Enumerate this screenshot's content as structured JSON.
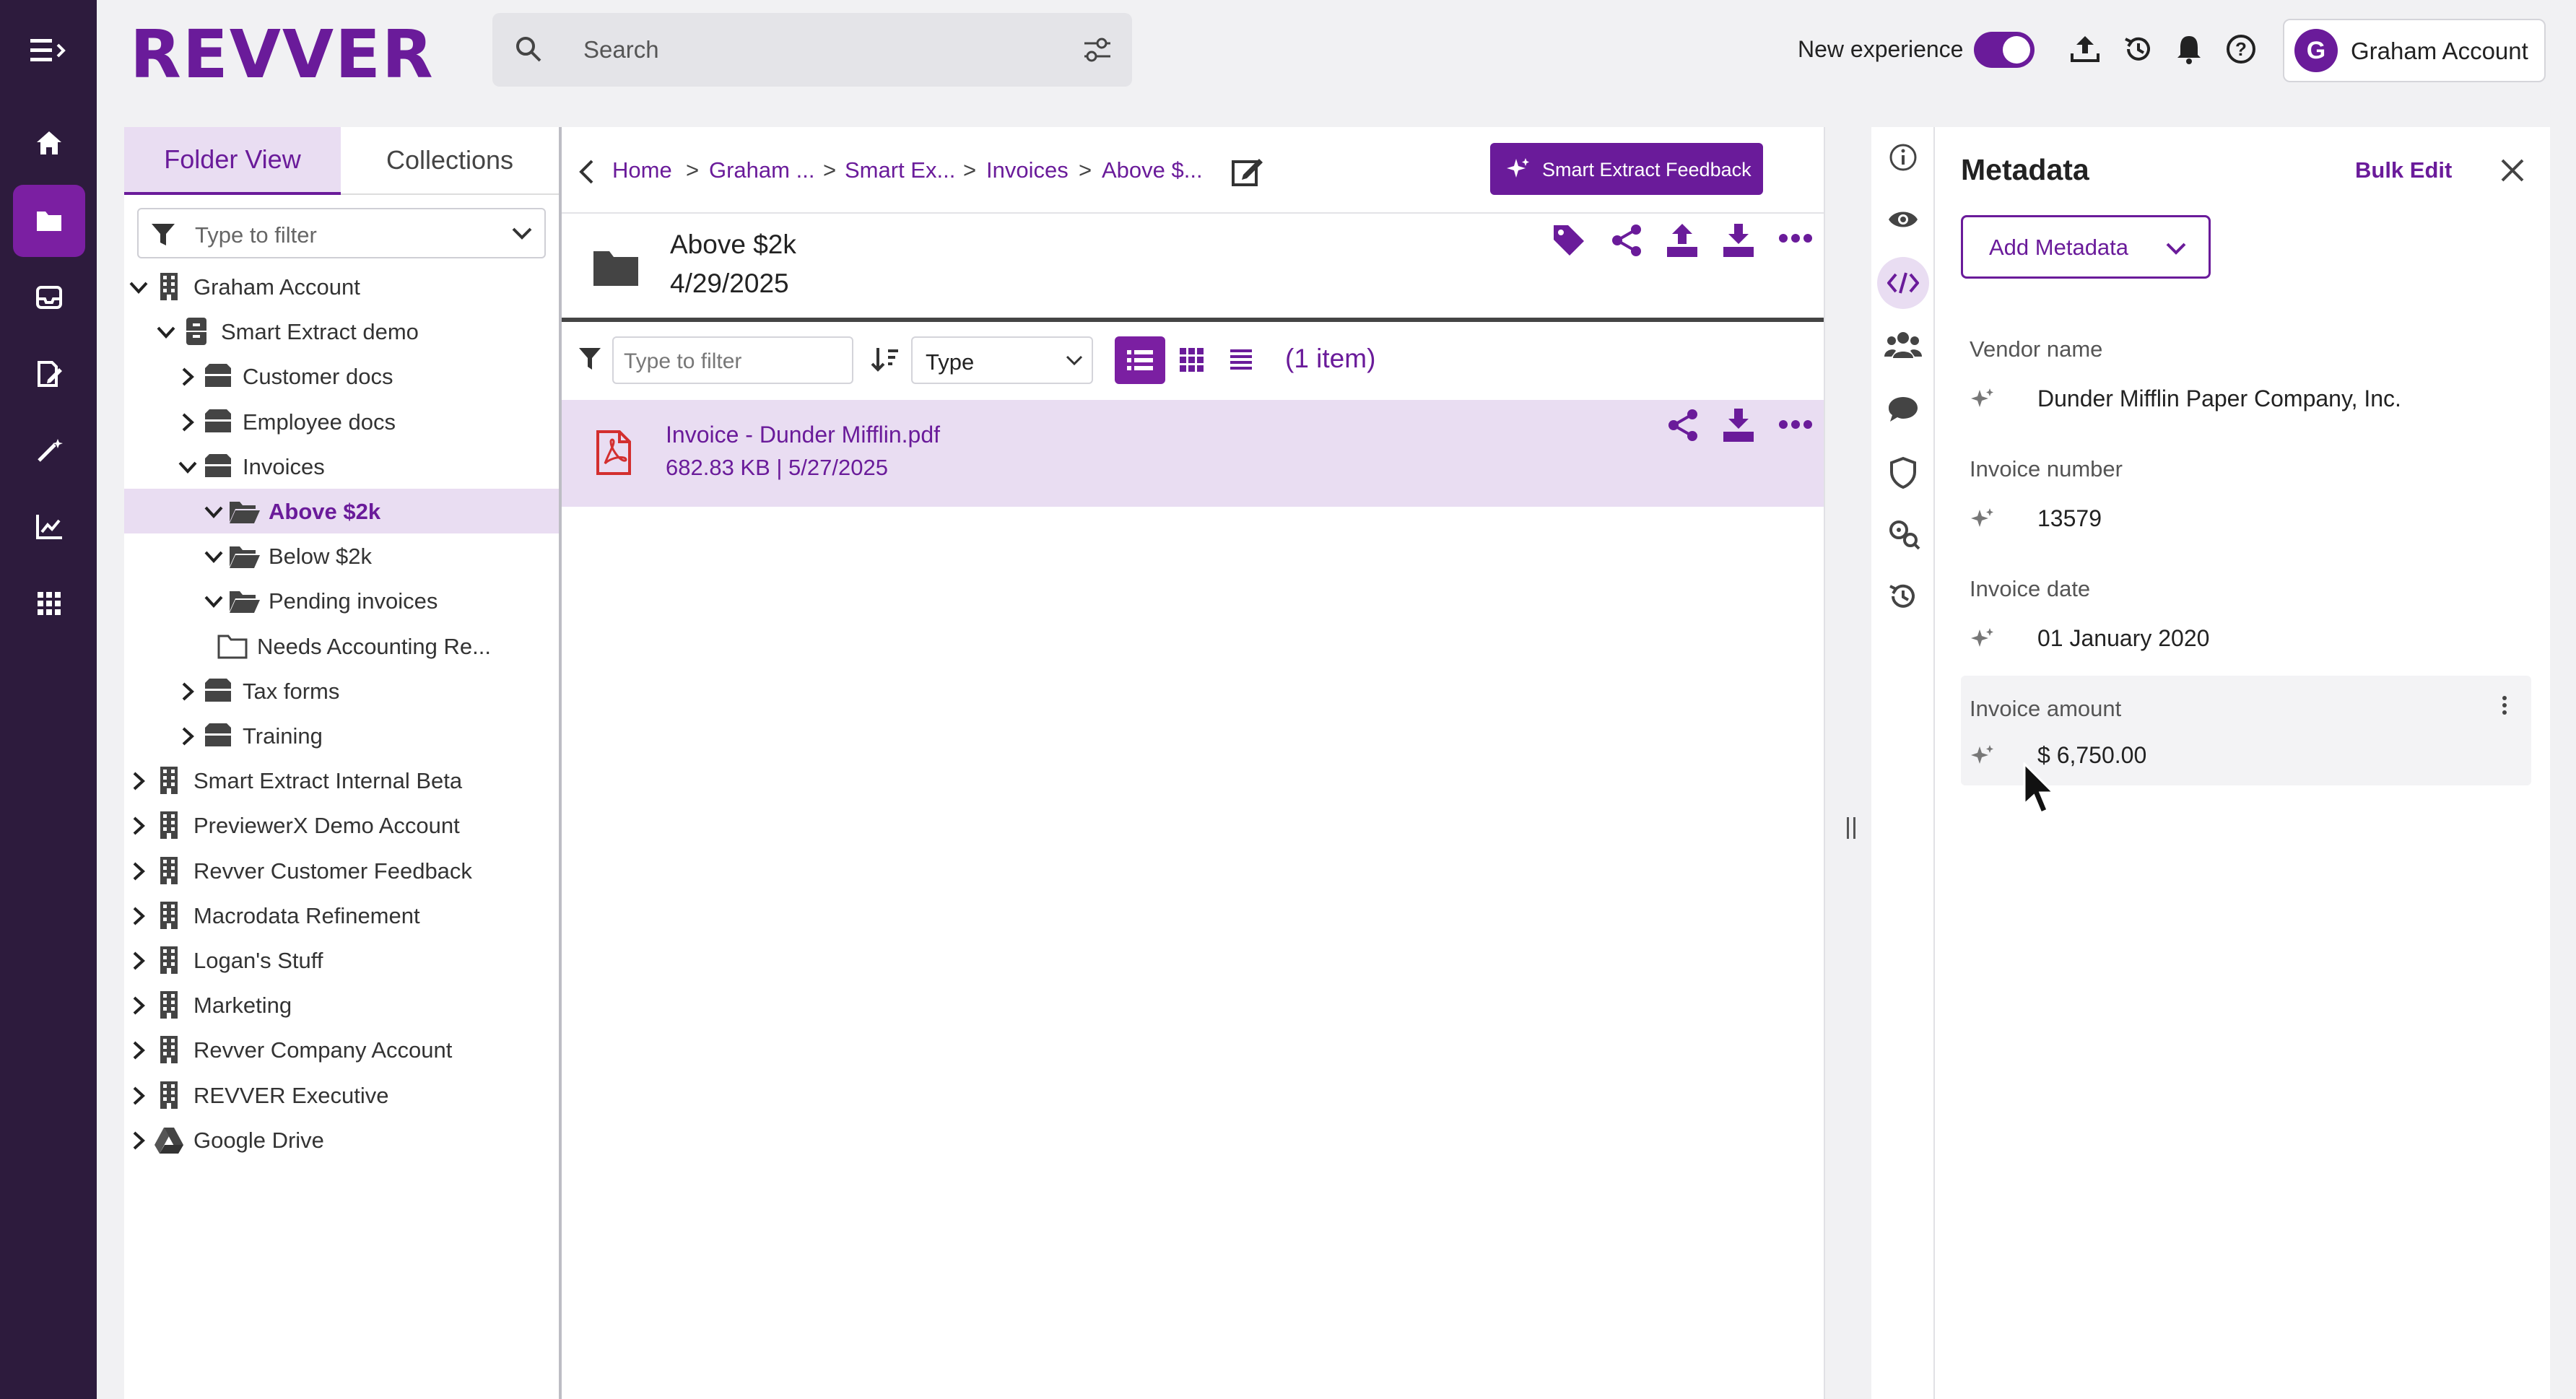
{
  "app": {
    "logo_text": "REVVER",
    "brand_color": "#6a1b9a",
    "accent_light": "#e9ddf2"
  },
  "rail": {
    "items": [
      {
        "icon": "menu-collapse-icon"
      },
      {
        "icon": "home-icon"
      },
      {
        "icon": "folder-icon",
        "active": true
      },
      {
        "icon": "inbox-icon"
      },
      {
        "icon": "edit-document-icon"
      },
      {
        "icon": "magic-wand-icon"
      },
      {
        "icon": "analytics-icon"
      },
      {
        "icon": "apps-grid-icon"
      }
    ]
  },
  "header": {
    "search_placeholder": "Search",
    "new_experience_label": "New experience",
    "new_experience_on": true,
    "account_initial": "G",
    "account_name": "Graham Account"
  },
  "left": {
    "tabs": [
      "Folder View",
      "Collections"
    ],
    "active_tab": "Folder View",
    "filter_placeholder": "Type to filter",
    "tree": [
      {
        "label": "Graham Account",
        "depth": 0,
        "icon": "building",
        "expanded": true
      },
      {
        "label": "Smart Extract demo",
        "depth": 1,
        "icon": "cabinet",
        "expanded": true
      },
      {
        "label": "Customer docs",
        "depth": 2,
        "icon": "drawer",
        "expanded": false
      },
      {
        "label": "Employee docs",
        "depth": 2,
        "icon": "drawer",
        "expanded": false
      },
      {
        "label": "Invoices",
        "depth": 2,
        "icon": "drawer",
        "expanded": true
      },
      {
        "label": "Above $2k",
        "depth": 3,
        "icon": "folder-open",
        "expanded": true,
        "selected": true
      },
      {
        "label": "Below $2k",
        "depth": 3,
        "icon": "folder-open",
        "expanded": true
      },
      {
        "label": "Pending invoices",
        "depth": 3,
        "icon": "folder-open",
        "expanded": true
      },
      {
        "label": "Needs Accounting Re...",
        "depth": 4,
        "icon": "folder-outline",
        "expanded": null
      },
      {
        "label": "Tax forms",
        "depth": 2,
        "icon": "drawer",
        "expanded": false
      },
      {
        "label": "Training",
        "depth": 2,
        "icon": "drawer",
        "expanded": false
      },
      {
        "label": "Smart Extract Internal Beta",
        "depth": 0,
        "icon": "building",
        "expanded": false
      },
      {
        "label": "PreviewerX Demo Account",
        "depth": 0,
        "icon": "building",
        "expanded": false
      },
      {
        "label": "Revver Customer Feedback",
        "depth": 0,
        "icon": "building",
        "expanded": false
      },
      {
        "label": "Macrodata Refinement",
        "depth": 0,
        "icon": "building",
        "expanded": false
      },
      {
        "label": "Logan's Stuff",
        "depth": 0,
        "icon": "building",
        "expanded": false
      },
      {
        "label": "Marketing",
        "depth": 0,
        "icon": "building",
        "expanded": false
      },
      {
        "label": "Revver Company Account",
        "depth": 0,
        "icon": "building",
        "expanded": false
      },
      {
        "label": "REVVER Executive",
        "depth": 0,
        "icon": "building",
        "expanded": false
      },
      {
        "label": "Google Drive",
        "depth": 0,
        "icon": "google-drive",
        "expanded": false
      }
    ]
  },
  "center": {
    "breadcrumbs": [
      "Home",
      "Graham ...",
      "Smart Ex...",
      "Invoices",
      "Above $..."
    ],
    "smart_extract_button": "Smart Extract Feedback",
    "folder_name": "Above $2k",
    "folder_date": "4/29/2025",
    "filter_placeholder": "Type to filter",
    "type_select": "Type",
    "item_count": "(1 item)",
    "files": [
      {
        "name": "Invoice - Dunder Mifflin.pdf",
        "meta": "682.83 KB | 5/27/2025"
      }
    ]
  },
  "right": {
    "title": "Metadata",
    "bulk_edit": "Bulk Edit",
    "add_metadata": "Add Metadata",
    "side_icons": [
      "info-icon",
      "eye-icon",
      "code-icon",
      "people-icon",
      "comment-icon",
      "shield-icon",
      "gear-search-icon",
      "history-icon"
    ],
    "fields": [
      {
        "label": "Vendor name",
        "value": "Dunder Mifflin Paper Company, Inc."
      },
      {
        "label": "Invoice number",
        "value": "13579"
      },
      {
        "label": "Invoice date",
        "value": "01 January 2020"
      },
      {
        "label": "Invoice amount",
        "value": "$ 6,750.00"
      }
    ]
  }
}
